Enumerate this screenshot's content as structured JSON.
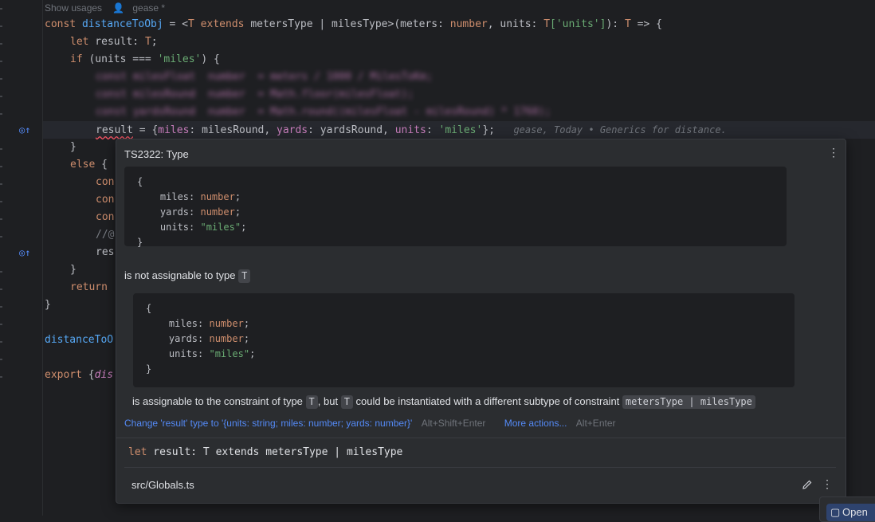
{
  "hints": {
    "usages": "Show usages",
    "author": "gease *"
  },
  "code": {
    "l1_const": "const",
    "l1_fn": "distanceToObj",
    "l1_rest_a": " = <",
    "l1_T": "T",
    "l1_extends": " extends ",
    "l1_types": "metersType | milesType>(meters: ",
    "l1_number": "number",
    "l1_units": ", units: ",
    "l1_T2": "T",
    "l1_idx": "['units']",
    "l1_close": "): ",
    "l1_T3": "T",
    "l1_arrow": " => {",
    "l2_let": "let",
    "l2_rest": " result: ",
    "l2_T": "T",
    "l2_semi": ";",
    "l3_if": "if",
    "l3_a": " (units === ",
    "l3_str": "'miles'",
    "l3_b": ") {",
    "l4": "const milesFloat  number  = meters / 1000 / MilesToKm;",
    "l5": "const milesRound  number  = Math.floor(milesFloat);",
    "l6": "const yardsRound  number  = Math.round((milesFloat - milesRound) * 1760);",
    "l7_result": "result",
    "l7_a": " = {",
    "l7_miles": "miles",
    "l7_b": ": milesRound, ",
    "l7_yards": "yards",
    "l7_c": ": yardsRound, ",
    "l7_units": "units",
    "l7_d": ": ",
    "l7_str": "'miles'",
    "l7_e": "};",
    "blame": "gease, Today • Generics for distance.",
    "l8": "}",
    "l9_else": "else",
    "l9_b": " {",
    "l10": "con",
    "l11": "con",
    "l12": "con",
    "l13": "//@",
    "l14": "res",
    "l15": "}",
    "l16": "return",
    "l17": "}",
    "l18": "distanceToO",
    "l19_export": "export",
    "l19_b": " {",
    "l19_dis": "dis"
  },
  "popup": {
    "title": "TS2322: Type",
    "block1": [
      "{",
      "    miles: number;",
      "    yards: number;",
      "    units: \"miles\";",
      "}"
    ],
    "not_assignable": "is not assignable to type",
    "type_T": "T",
    "block2": [
      "{",
      "    miles: number;",
      "    yards: number;",
      "    units: \"miles\";",
      "}"
    ],
    "assign_a": "is assignable to the constraint of type",
    "assign_b": ", but",
    "assign_c": "could be instantiated with a different subtype of constraint",
    "constraint": "metersType | milesType",
    "action1": "Change 'result' type to '{units: string; miles: number; yards: number}'",
    "action1_shortcut": "Alt+Shift+Enter",
    "action2": "More actions...",
    "action2_shortcut": "Alt+Enter",
    "sig_let": "let",
    "sig_rest": " result: T extends metersType | milesType",
    "file": "src/Globals.ts"
  },
  "open_button": {
    "label": "Open"
  }
}
